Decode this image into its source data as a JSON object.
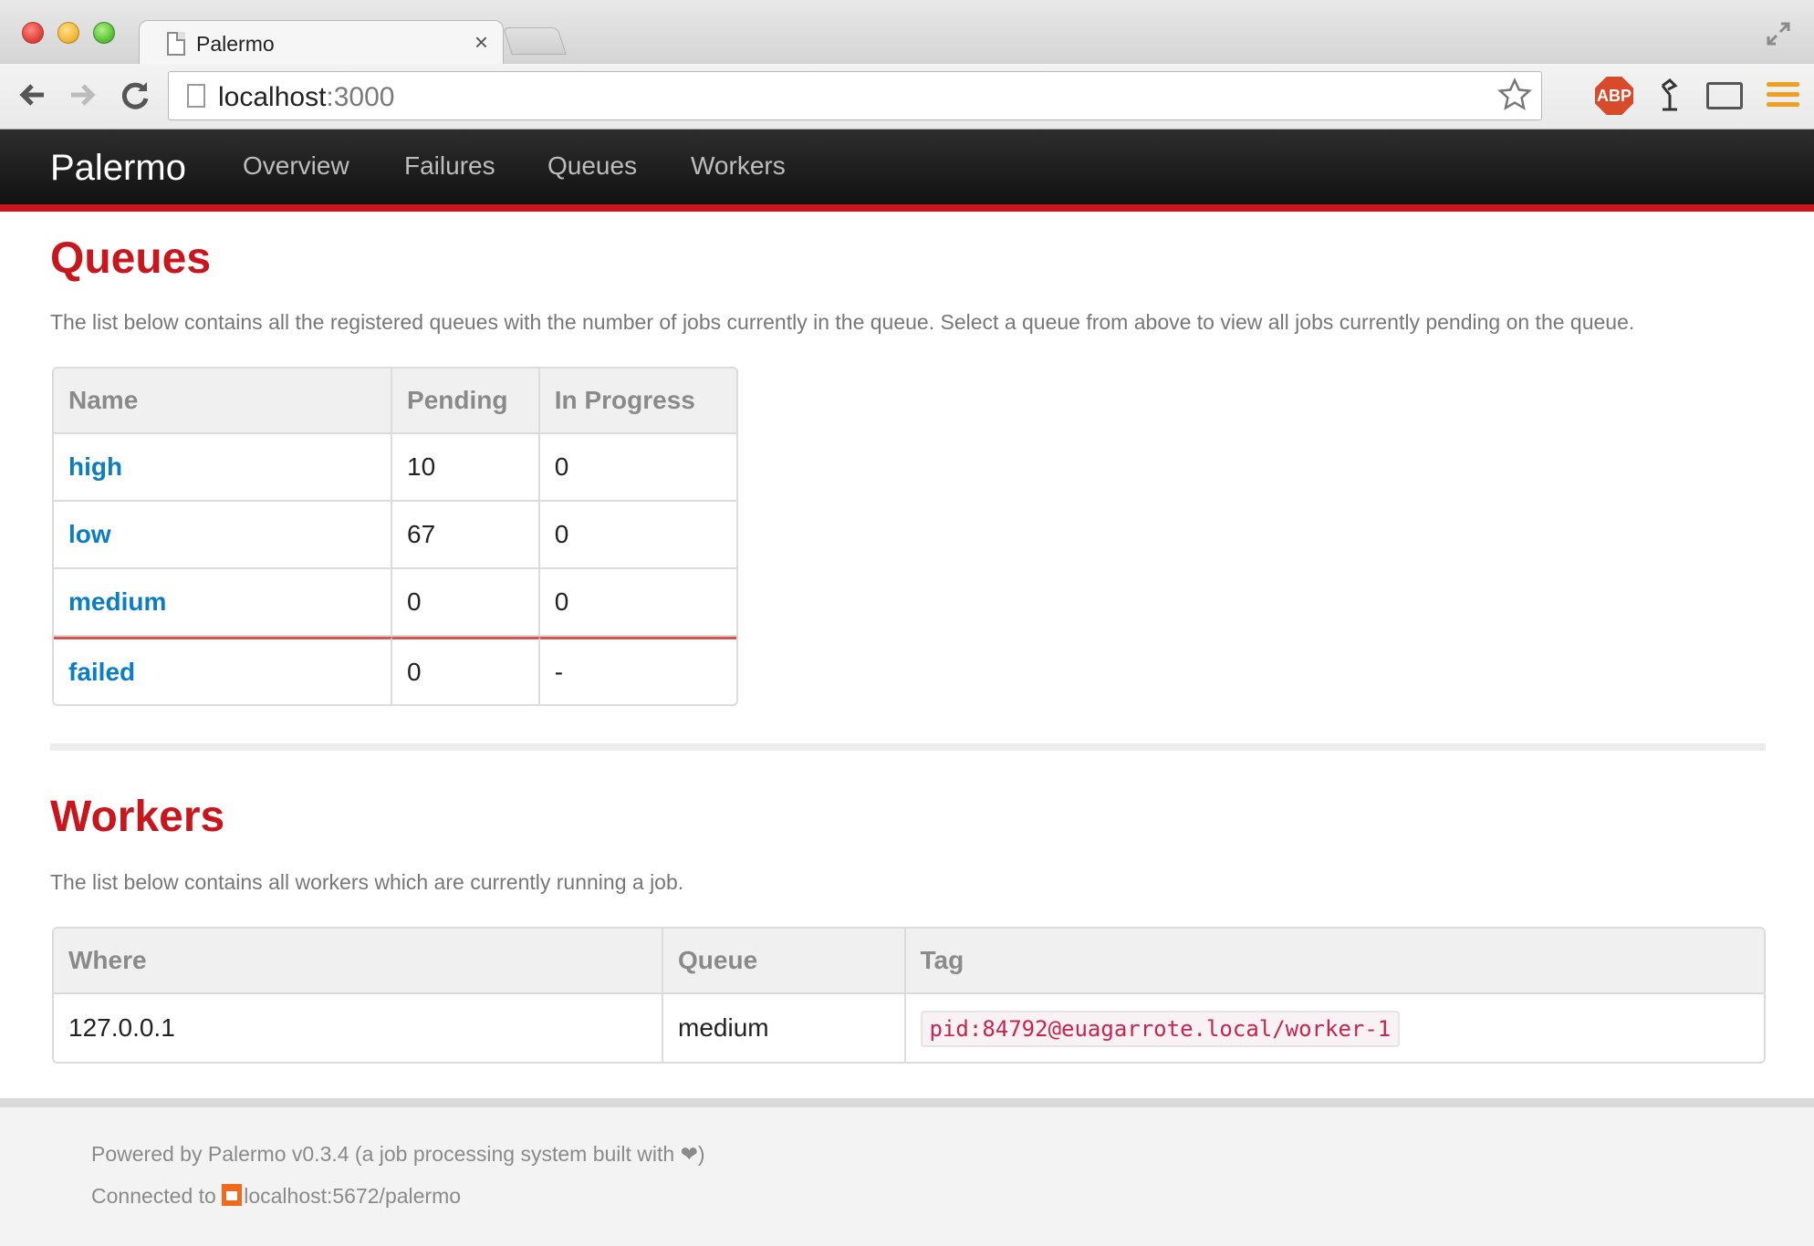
{
  "browser": {
    "tab_title": "Palermo",
    "tab_close": "×",
    "url_host": "localhost",
    "url_port": ":3000",
    "icons": [
      "page-icon",
      "back-arrow-icon",
      "forward-arrow-icon",
      "reload-icon",
      "star-icon",
      "adblock-icon",
      "lamp-icon",
      "cast-icon",
      "chrome-menu-icon",
      "fullscreen-icon"
    ],
    "abp_label": "ABP"
  },
  "navbar": {
    "brand": "Palermo",
    "links": [
      {
        "label": "Overview"
      },
      {
        "label": "Failures"
      },
      {
        "label": "Queues"
      },
      {
        "label": "Workers"
      }
    ],
    "accent_color": "#c9161d"
  },
  "queues": {
    "title": "Queues",
    "description": "The list below contains all the registered queues with the number of jobs currently in the queue. Select a queue from above to view all jobs currently pending on the queue.",
    "columns": [
      "Name",
      "Pending",
      "In Progress"
    ],
    "rows": [
      {
        "name": "high",
        "pending": "10",
        "in_progress": "0"
      },
      {
        "name": "low",
        "pending": "67",
        "in_progress": "0"
      },
      {
        "name": "medium",
        "pending": "0",
        "in_progress": "0"
      },
      {
        "name": "failed",
        "pending": "0",
        "in_progress": "-"
      }
    ]
  },
  "workers": {
    "title": "Workers",
    "description": "The list below contains all workers which are currently running a job.",
    "columns": [
      "Where",
      "Queue",
      "Tag"
    ],
    "rows": [
      {
        "where": "127.0.0.1",
        "queue": "medium",
        "tag": "pid:84792@euagarrote.local/worker-1"
      }
    ]
  },
  "footer": {
    "powered_by": "Powered by Palermo v0.3.4 (a job processing system built with",
    "heart": "❤",
    "powered_close": ")",
    "connected_prefix": "Connected to",
    "connection": "localhost:5672/palermo"
  }
}
